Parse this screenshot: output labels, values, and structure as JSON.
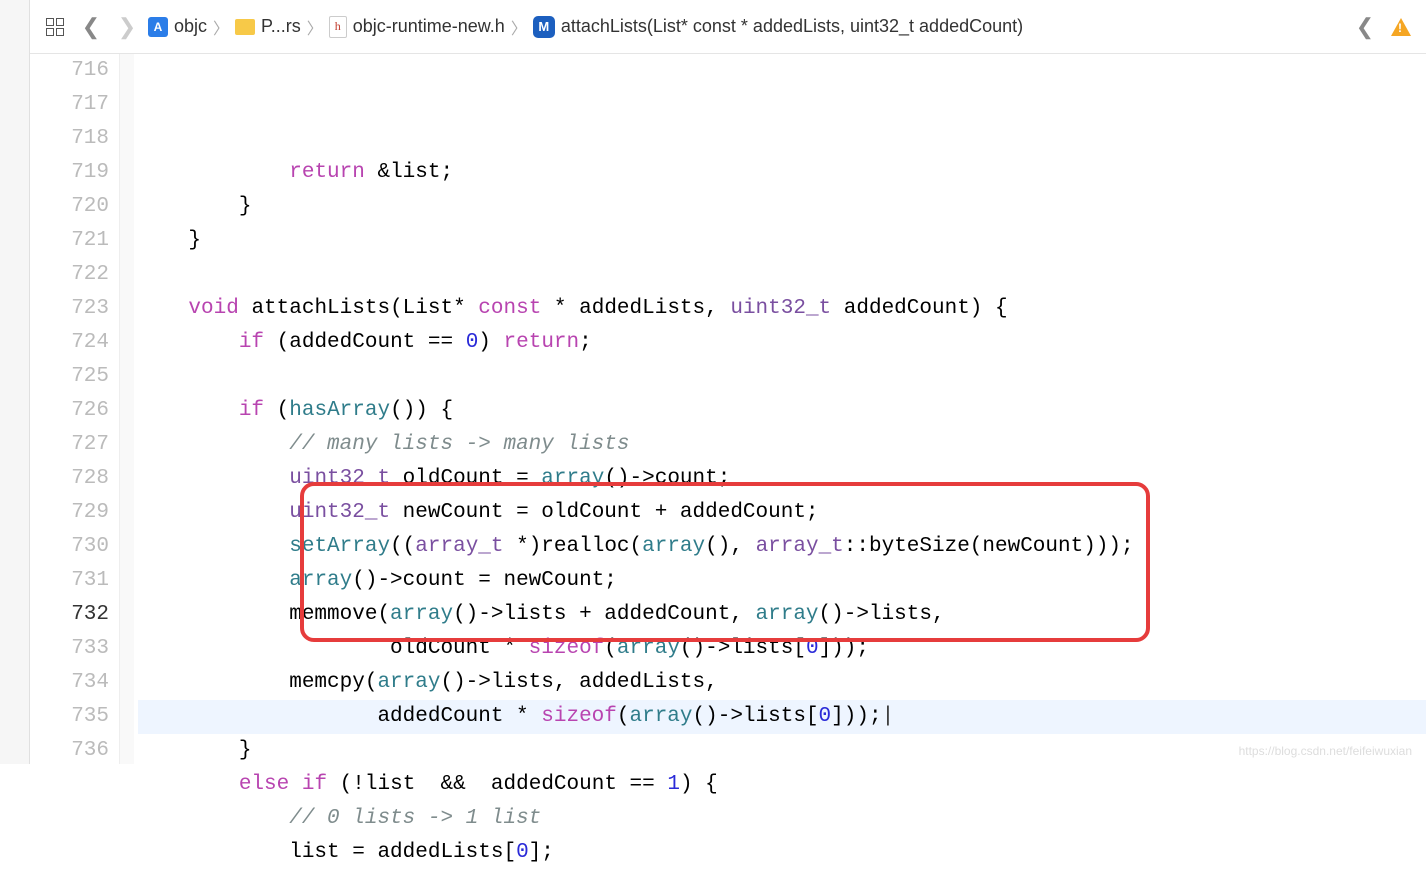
{
  "breadcrumb": {
    "project": "objc",
    "folder": "P...rs",
    "file": "objc-runtime-new.h",
    "symbol": "attachLists(List* const * addedLists, uint32_t addedCount)"
  },
  "gutter": {
    "start": 716,
    "end": 736,
    "current": 732
  },
  "code": [
    {
      "n": 716,
      "tokens": [
        {
          "t": "            ",
          "c": ""
        },
        {
          "t": "return",
          "c": "kw"
        },
        {
          "t": " &list;",
          "c": ""
        }
      ]
    },
    {
      "n": 717,
      "tokens": [
        {
          "t": "        }",
          "c": ""
        }
      ]
    },
    {
      "n": 718,
      "tokens": [
        {
          "t": "    }",
          "c": ""
        }
      ]
    },
    {
      "n": 719,
      "tokens": [
        {
          "t": "",
          "c": ""
        }
      ]
    },
    {
      "n": 720,
      "tokens": [
        {
          "t": "    ",
          "c": ""
        },
        {
          "t": "void",
          "c": "kw"
        },
        {
          "t": " attachLists(List* ",
          "c": ""
        },
        {
          "t": "const",
          "c": "kw"
        },
        {
          "t": " * addedLists, ",
          "c": ""
        },
        {
          "t": "uint32_t",
          "c": "typ"
        },
        {
          "t": " addedCount) {",
          "c": ""
        }
      ]
    },
    {
      "n": 721,
      "tokens": [
        {
          "t": "        ",
          "c": ""
        },
        {
          "t": "if",
          "c": "kw"
        },
        {
          "t": " (addedCount == ",
          "c": ""
        },
        {
          "t": "0",
          "c": "num"
        },
        {
          "t": ") ",
          "c": ""
        },
        {
          "t": "return",
          "c": "kw"
        },
        {
          "t": ";",
          "c": ""
        }
      ]
    },
    {
      "n": 722,
      "tokens": [
        {
          "t": "",
          "c": ""
        }
      ]
    },
    {
      "n": 723,
      "tokens": [
        {
          "t": "        ",
          "c": ""
        },
        {
          "t": "if",
          "c": "kw"
        },
        {
          "t": " (",
          "c": ""
        },
        {
          "t": "hasArray",
          "c": "fn"
        },
        {
          "t": "()) {",
          "c": ""
        }
      ]
    },
    {
      "n": 724,
      "tokens": [
        {
          "t": "            ",
          "c": ""
        },
        {
          "t": "// many lists -> many lists",
          "c": "cmt"
        }
      ]
    },
    {
      "n": 725,
      "tokens": [
        {
          "t": "            ",
          "c": ""
        },
        {
          "t": "uint32_t",
          "c": "typ"
        },
        {
          "t": " oldCount = ",
          "c": ""
        },
        {
          "t": "array",
          "c": "fn"
        },
        {
          "t": "()->count;",
          "c": ""
        }
      ]
    },
    {
      "n": 726,
      "tokens": [
        {
          "t": "            ",
          "c": ""
        },
        {
          "t": "uint32_t",
          "c": "typ"
        },
        {
          "t": " newCount = oldCount + addedCount;",
          "c": ""
        }
      ]
    },
    {
      "n": 727,
      "tokens": [
        {
          "t": "            ",
          "c": ""
        },
        {
          "t": "setArray",
          "c": "fn"
        },
        {
          "t": "((",
          "c": ""
        },
        {
          "t": "array_t",
          "c": "typ"
        },
        {
          "t": " *)realloc(",
          "c": ""
        },
        {
          "t": "array",
          "c": "fn"
        },
        {
          "t": "(), ",
          "c": ""
        },
        {
          "t": "array_t",
          "c": "typ"
        },
        {
          "t": "::byteSize(newCount)));",
          "c": ""
        }
      ]
    },
    {
      "n": 728,
      "tokens": [
        {
          "t": "            ",
          "c": ""
        },
        {
          "t": "array",
          "c": "fn"
        },
        {
          "t": "()->count = newCount;",
          "c": ""
        }
      ]
    },
    {
      "n": 729,
      "tokens": [
        {
          "t": "            memmove(",
          "c": ""
        },
        {
          "t": "array",
          "c": "fn"
        },
        {
          "t": "()->lists + addedCount, ",
          "c": ""
        },
        {
          "t": "array",
          "c": "fn"
        },
        {
          "t": "()->lists,",
          "c": ""
        }
      ]
    },
    {
      "n": 730,
      "tokens": [
        {
          "t": "                    oldCount * ",
          "c": ""
        },
        {
          "t": "sizeof",
          "c": "kw"
        },
        {
          "t": "(",
          "c": ""
        },
        {
          "t": "array",
          "c": "fn"
        },
        {
          "t": "()->lists[",
          "c": ""
        },
        {
          "t": "0",
          "c": "num"
        },
        {
          "t": "]));",
          "c": ""
        }
      ]
    },
    {
      "n": 731,
      "tokens": [
        {
          "t": "            memcpy(",
          "c": ""
        },
        {
          "t": "array",
          "c": "fn"
        },
        {
          "t": "()->lists, addedLists,",
          "c": ""
        }
      ]
    },
    {
      "n": 732,
      "tokens": [
        {
          "t": "                   addedCount * ",
          "c": ""
        },
        {
          "t": "sizeof",
          "c": "kw"
        },
        {
          "t": "(",
          "c": ""
        },
        {
          "t": "array",
          "c": "fn"
        },
        {
          "t": "()->lists[",
          "c": ""
        },
        {
          "t": "0",
          "c": "num"
        },
        {
          "t": "]));",
          "c": ""
        }
      ],
      "cursor": true
    },
    {
      "n": 733,
      "tokens": [
        {
          "t": "        }",
          "c": ""
        }
      ]
    },
    {
      "n": 734,
      "tokens": [
        {
          "t": "        ",
          "c": ""
        },
        {
          "t": "else",
          "c": "kw"
        },
        {
          "t": " ",
          "c": ""
        },
        {
          "t": "if",
          "c": "kw"
        },
        {
          "t": " (!list  &&  addedCount == ",
          "c": ""
        },
        {
          "t": "1",
          "c": "num"
        },
        {
          "t": ") {",
          "c": ""
        }
      ]
    },
    {
      "n": 735,
      "tokens": [
        {
          "t": "            ",
          "c": ""
        },
        {
          "t": "// 0 lists -> 1 list",
          "c": "cmt"
        }
      ]
    },
    {
      "n": 736,
      "tokens": [
        {
          "t": "            list = addedLists[",
          "c": ""
        },
        {
          "t": "0",
          "c": "num"
        },
        {
          "t": "];",
          "c": ""
        }
      ]
    }
  ],
  "highlight_box": {
    "top_line": 729,
    "bottom_line": 732
  },
  "watermark": "https://blog.csdn.net/feifeiwuxian"
}
